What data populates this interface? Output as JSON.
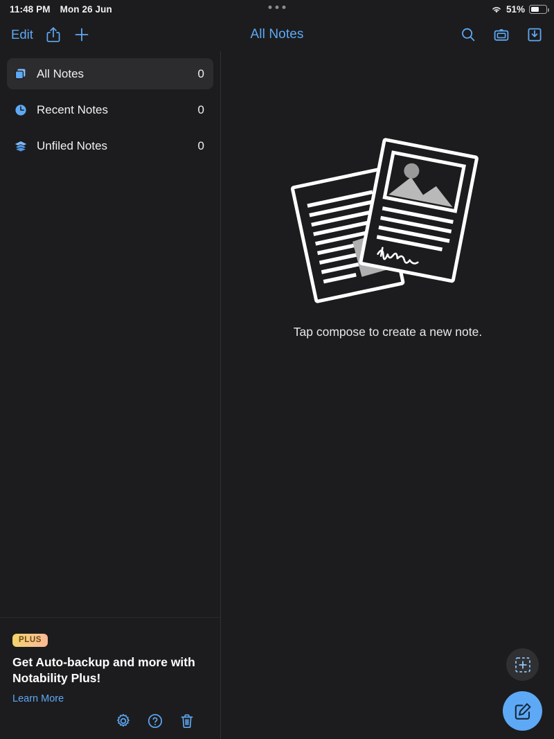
{
  "status_bar": {
    "time": "11:48 PM",
    "date": "Mon 26 Jun",
    "battery_percent": "51%",
    "wifi_icon": "wifi-icon",
    "battery_icon": "battery-icon",
    "multitask_dots": "multitask-dots-icon"
  },
  "nav_bar": {
    "edit_label": "Edit",
    "share_icon": "share-icon",
    "add_icon": "plus-icon",
    "title": "All Notes",
    "search_icon": "search-icon",
    "presentation_icon": "presentation-icon",
    "import_icon": "import-download-icon"
  },
  "sidebar": {
    "items": [
      {
        "label": "All Notes",
        "count": "0",
        "icon": "notes-stack-icon",
        "selected": true
      },
      {
        "label": "Recent Notes",
        "count": "0",
        "icon": "clock-icon",
        "selected": false
      },
      {
        "label": "Unfiled Notes",
        "count": "0",
        "icon": "layers-icon",
        "selected": false
      }
    ],
    "promo": {
      "badge": "PLUS",
      "title": "Get Auto-backup and more with Notability Plus!",
      "link": "Learn More",
      "tools": [
        {
          "icon": "gear-icon",
          "name": "settings-button"
        },
        {
          "icon": "question-circle-icon",
          "name": "help-button"
        },
        {
          "icon": "trash-icon",
          "name": "trash-button"
        }
      ]
    }
  },
  "main": {
    "empty_illustration": "two-documents-illustration",
    "empty_message": "Tap compose to create a new note.",
    "fab_small_icon": "dashed-square-plus-icon",
    "fab_main_icon": "compose-pencil-icon"
  },
  "colors": {
    "background": "#1c1c1e",
    "accent_blue": "#5ea9f5",
    "selected_row": "#2c2c2e",
    "divider": "#313135",
    "plus_badge_start": "#f3d468",
    "plus_badge_end": "#fab894",
    "fab_small_bg": "#303033"
  }
}
